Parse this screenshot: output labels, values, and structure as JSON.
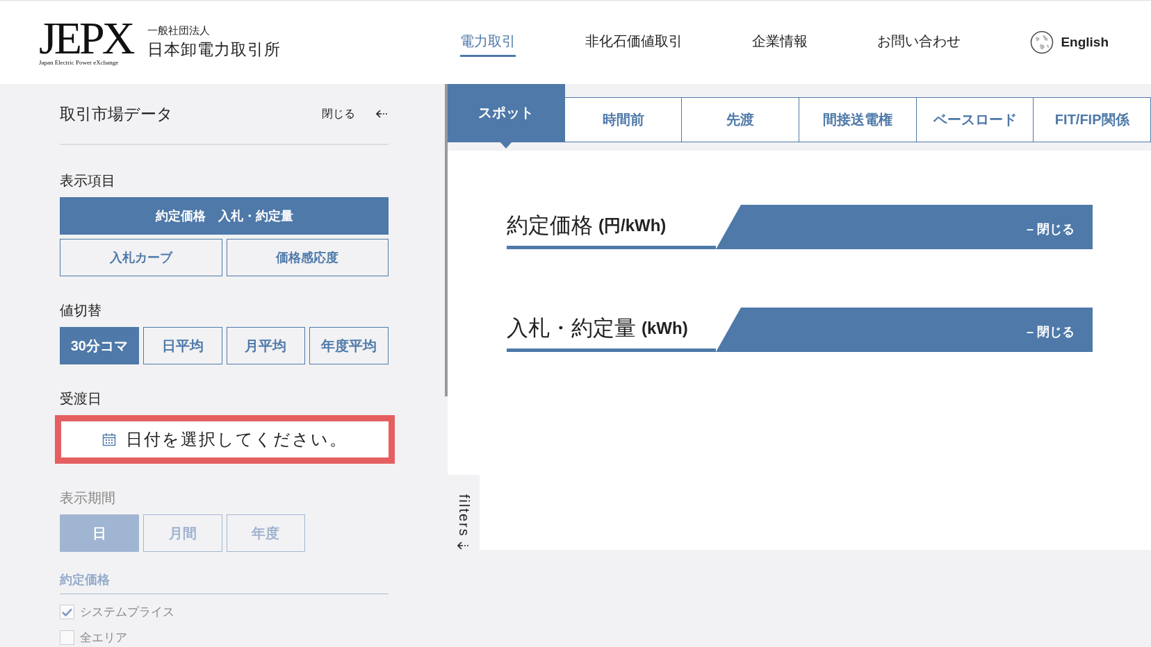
{
  "header": {
    "logo": "JEPX",
    "logo_subtitle": "Japan Electric Power eXchange",
    "org_type": "一般社団法人",
    "org_name": "日本卸電力取引所",
    "nav": [
      {
        "label": "電力取引",
        "selected": true
      },
      {
        "label": "非化石価値取引",
        "selected": false
      },
      {
        "label": "企業情報",
        "selected": false
      },
      {
        "label": "お問い合わせ",
        "selected": false
      }
    ],
    "language": "English"
  },
  "panel": {
    "title": "取引市場データ",
    "close": "閉じる",
    "display_items": {
      "label": "表示項目",
      "options": [
        {
          "label": "約定価格　入札・約定量",
          "selected": true,
          "wide": true
        },
        {
          "label": "入札カーブ",
          "selected": false,
          "wide": false
        },
        {
          "label": "価格感応度",
          "selected": false,
          "wide": false
        }
      ]
    },
    "value_switch": {
      "label": "値切替",
      "options": [
        {
          "label": "30分コマ",
          "selected": true
        },
        {
          "label": "日平均",
          "selected": false
        },
        {
          "label": "月平均",
          "selected": false
        },
        {
          "label": "年度平均",
          "selected": false
        }
      ]
    },
    "delivery_date": {
      "label": "受渡日",
      "placeholder": "日付を選択してください。",
      "error": true
    },
    "display_period": {
      "label": "表示期間",
      "disabled": true,
      "options": [
        {
          "label": "日",
          "selected": true
        },
        {
          "label": "月間",
          "selected": false
        },
        {
          "label": "年度",
          "selected": false
        }
      ]
    },
    "price_filter": {
      "label": "約定価格",
      "disabled": true,
      "items": [
        {
          "label": "システムプライス",
          "checked": true
        },
        {
          "label": "全エリア",
          "checked": false
        }
      ]
    }
  },
  "tabs": [
    {
      "label": "スポット",
      "selected": true
    },
    {
      "label": "時間前",
      "selected": false
    },
    {
      "label": "先渡",
      "selected": false
    },
    {
      "label": "間接送電権",
      "selected": false
    },
    {
      "label": "ベースロード",
      "selected": false
    },
    {
      "label": "FIT/FIP関係",
      "selected": false
    }
  ],
  "filters_tab": "filters",
  "sections": [
    {
      "title": "約定価格",
      "unit": "(円/kWh)",
      "close": "– 閉じる"
    },
    {
      "title": "入札・約定量",
      "unit": "(kWh)",
      "close": "– 閉じる"
    }
  ]
}
